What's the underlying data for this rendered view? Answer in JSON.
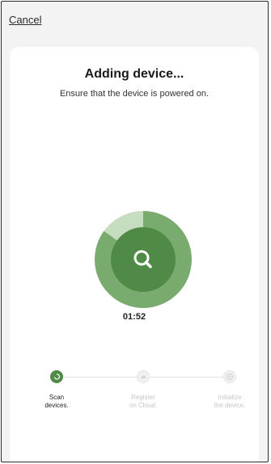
{
  "header": {
    "cancel_label": "Cancel"
  },
  "main": {
    "title": "Adding device...",
    "subtitle": "Ensure that the device is powered on.",
    "timer": "01:52",
    "progress_fraction": 0.85
  },
  "steps": [
    {
      "label": "Scan\ndevices.",
      "state": "active",
      "icon": "check-icon"
    },
    {
      "label": "Register\non Cloud.",
      "state": "inactive",
      "icon": "cloud-icon"
    },
    {
      "label": "Initialize\nthe device.",
      "state": "inactive",
      "icon": "gear-icon"
    }
  ],
  "colors": {
    "accent": "#4f8a46",
    "ring_progress": "#7aab6e",
    "ring_track": "#c7ddbf",
    "background": "#f3f3f3"
  }
}
